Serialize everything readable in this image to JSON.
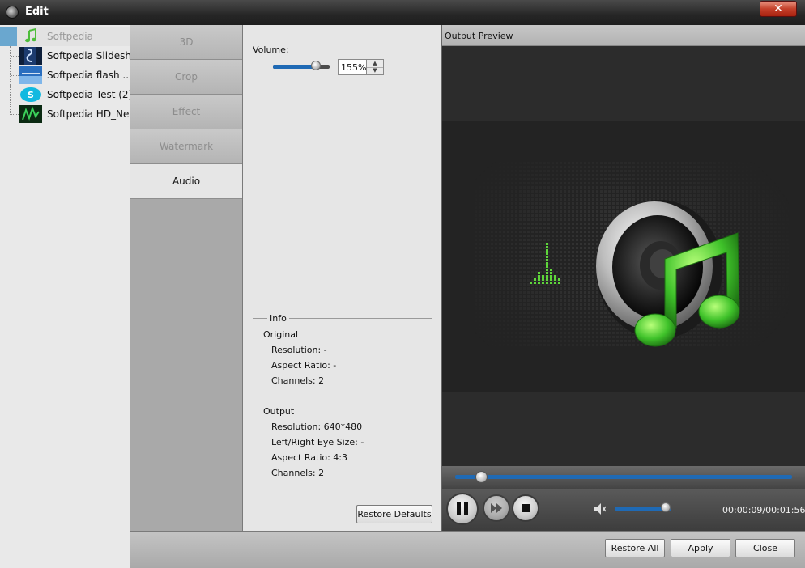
{
  "window": {
    "title": "Edit",
    "close_label": "✕"
  },
  "files": [
    {
      "label": "Softpedia",
      "thumb": "music-note-icon",
      "active": true
    },
    {
      "label": "Softpedia Slidesh...",
      "thumb": "video-thumbnail"
    },
    {
      "label": "Softpedia flash ...",
      "thumb": "video-thumbnail"
    },
    {
      "label": "Softpedia Test (2)",
      "thumb": "video-thumbnail"
    },
    {
      "label": "Softpedia HD_New",
      "thumb": "video-thumbnail"
    }
  ],
  "tabs": [
    {
      "label": "3D"
    },
    {
      "label": "Crop"
    },
    {
      "label": "Effect"
    },
    {
      "label": "Watermark"
    },
    {
      "label": "Audio",
      "active": true
    }
  ],
  "audio": {
    "volume_label": "Volume:",
    "volume_value": "155%",
    "volume_fraction": 0.75
  },
  "info": {
    "title": "Info",
    "original_label": "Original",
    "original": {
      "resolution": "Resolution: -",
      "aspect_ratio": "Aspect Ratio: -",
      "channels": "Channels: 2"
    },
    "output_label": "Output",
    "output": {
      "resolution": "Resolution: 640*480",
      "eye_size": "Left/Right Eye Size: -",
      "aspect_ratio": "Aspect Ratio: 4:3",
      "channels": "Channels: 2"
    }
  },
  "restore_defaults_label": "Restore Defaults",
  "preview": {
    "title": "Output Preview",
    "time": "00:00:09/00:01:56",
    "seek_fraction": 0.077,
    "volume_fraction": 0.9
  },
  "buttons": {
    "restore_all": "Restore All",
    "apply": "Apply",
    "close": "Close"
  },
  "colors": {
    "accent_blue": "#1f6ab5",
    "equalizer_green": "#5ed63a",
    "note_green": "#3fc22a"
  }
}
